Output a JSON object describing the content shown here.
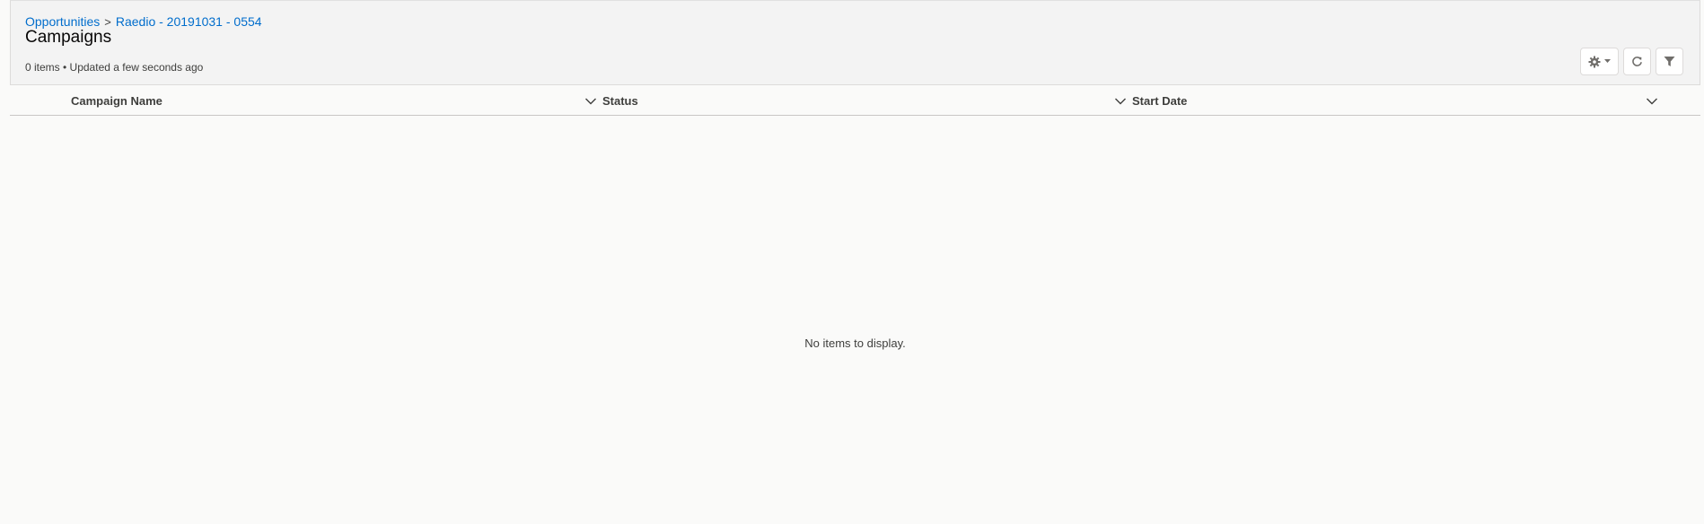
{
  "header": {
    "breadcrumb": [
      {
        "label": "Opportunities"
      },
      {
        "label": "Raedio - 20191031 - 0554"
      }
    ],
    "breadcrumb_separator": ">",
    "title": "Campaigns",
    "status": "0 items • Updated a few seconds ago"
  },
  "toolbar": {
    "settings_icon": "gear-icon",
    "settings_dropdown_icon": "caret-down-icon",
    "refresh_icon": "refresh-icon",
    "filter_icon": "filter-icon"
  },
  "table": {
    "columns": [
      {
        "label": "Campaign Name",
        "menu_icon": "chevron-down-icon"
      },
      {
        "label": "Status",
        "menu_icon": "chevron-down-icon"
      },
      {
        "label": "Start Date",
        "menu_icon": "chevron-down-icon"
      }
    ],
    "rows": [],
    "empty_message": "No items to display."
  },
  "colors": {
    "link": "#006dcc",
    "header_bg": "#f3f3f3",
    "page_bg": "#fafaf9",
    "border": "#dddbda",
    "text": "#3e3e3c"
  }
}
